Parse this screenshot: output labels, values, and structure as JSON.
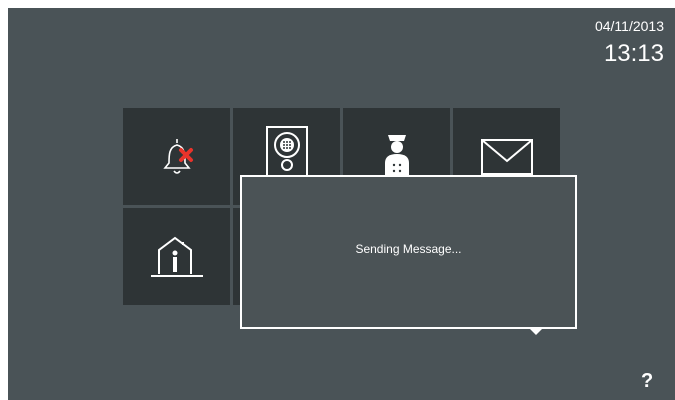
{
  "status": {
    "date": "04/11/2013",
    "time": "13:13"
  },
  "tiles": [
    {
      "name": "do-not-disturb",
      "icon": "bell-muted-icon"
    },
    {
      "name": "outdoor-panel",
      "icon": "intercom-panel-icon"
    },
    {
      "name": "concierge",
      "icon": "concierge-icon"
    },
    {
      "name": "messages",
      "icon": "envelope-icon"
    },
    {
      "name": "home-automation",
      "icon": "home-icon"
    },
    {
      "name": "hidden-tile",
      "icon": "none"
    }
  ],
  "dialog": {
    "message": "Sending Message..."
  },
  "help": {
    "label": "?"
  },
  "colors": {
    "background": "#4a5357",
    "tile": "#2e3436",
    "accent_red": "#e8332b"
  }
}
